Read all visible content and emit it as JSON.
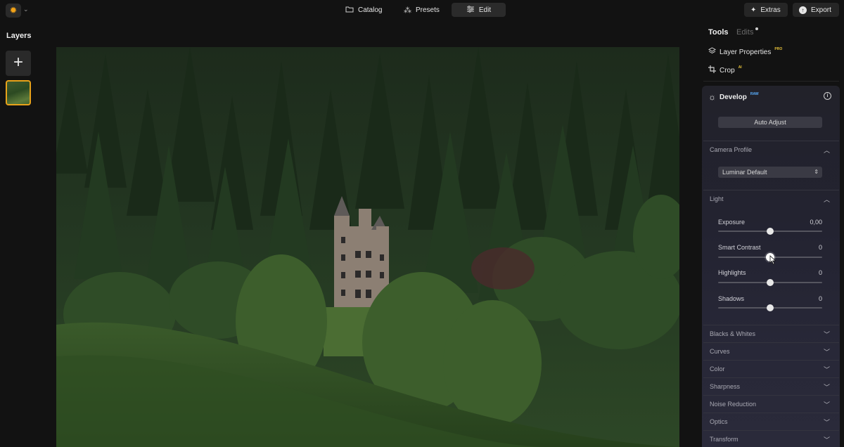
{
  "topbar": {
    "logo_icon": "sun-icon",
    "nav": [
      {
        "label": "Catalog",
        "icon": "folder-icon"
      },
      {
        "label": "Presets",
        "icon": "sparkle-icon"
      },
      {
        "label": "Edit",
        "icon": "sliders-icon"
      }
    ],
    "extras_label": "Extras",
    "export_label": "Export"
  },
  "left": {
    "title": "Layers",
    "add_icon": "plus-icon"
  },
  "right": {
    "tabs": {
      "tools": "Tools",
      "edits": "Edits"
    },
    "tools": [
      {
        "label": "Layer Properties",
        "badge": "PRO",
        "icon": "layers-icon"
      },
      {
        "label": "Crop",
        "badge": "AI",
        "icon": "crop-icon"
      }
    ],
    "develop": {
      "title": "Develop",
      "badge": "RAW",
      "auto_adjust_label": "Auto Adjust",
      "camera_profile": {
        "title": "Camera Profile",
        "value": "Luminar Default"
      },
      "light": {
        "title": "Light",
        "sliders": [
          {
            "label": "Exposure",
            "value": "0,00",
            "level": 0.5
          },
          {
            "label": "Smart Contrast",
            "value": "0",
            "level": 0.5,
            "active": true
          },
          {
            "label": "Highlights",
            "value": "0",
            "level": 0.5
          },
          {
            "label": "Shadows",
            "value": "0",
            "level": 0.5
          }
        ]
      },
      "collapsed_sections": [
        "Blacks & Whites",
        "Curves",
        "Color",
        "Sharpness",
        "Noise Reduction",
        "Optics",
        "Transform"
      ]
    }
  },
  "colors": {
    "accent_orange": "#e8a21a",
    "background": "#121212",
    "panel": "#232331"
  }
}
